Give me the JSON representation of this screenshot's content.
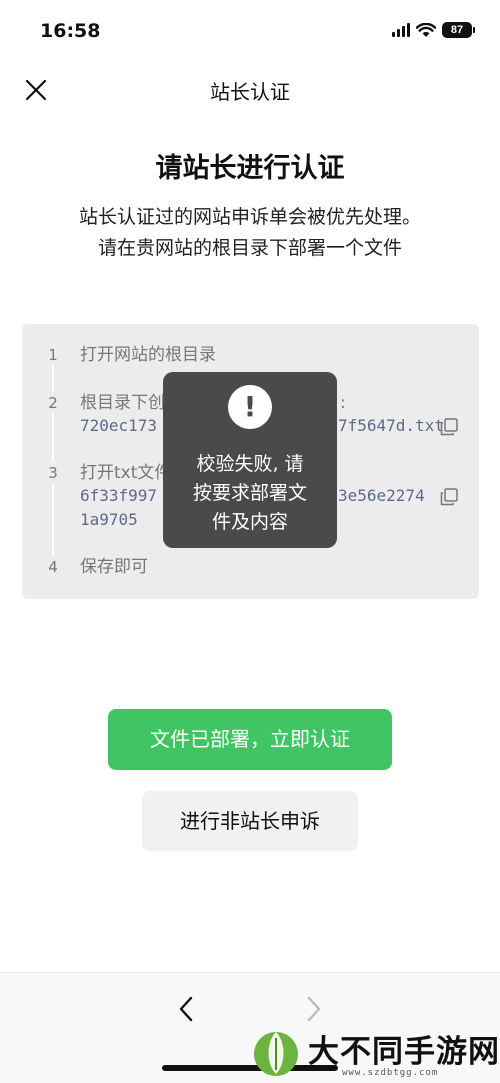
{
  "status_bar": {
    "time": "16:58",
    "battery": "87"
  },
  "nav": {
    "title": "站长认证"
  },
  "heading": "请站长进行认证",
  "description": [
    "站长认证过的网站申诉单会被优先处理。",
    "请在贵网站的根目录下部署一个文件"
  ],
  "steps": [
    {
      "number": "1",
      "text": "打开网站的根目录"
    },
    {
      "number": "2",
      "text": "根目录下创",
      "text_tail": ":",
      "code": "720ec173",
      "code_tail": "7f5647d.txt"
    },
    {
      "number": "3",
      "text": "打开txt文件",
      "code_line1": "6f33f997",
      "code_line1_tail": "3e56e2274",
      "code_line2": "1a9705"
    },
    {
      "number": "4",
      "text": "保存即可"
    }
  ],
  "toast": {
    "icon": "!",
    "message": [
      "校验失败, 请",
      "按要求部署文",
      "件及内容"
    ]
  },
  "buttons": {
    "primary": "文件已部署，立即认证",
    "secondary": "进行非站长申诉"
  },
  "watermark": {
    "text": "大不同手游网",
    "url": "www.szdbtgg.com"
  },
  "colors": {
    "primary_green": "#41c464",
    "toast_bg": "#4a4a4a",
    "card_bg": "#ececec"
  },
  "icons": [
    "close-icon",
    "alert-icon",
    "copy-icon",
    "back-arrow-icon",
    "forward-arrow-icon",
    "wifi-icon",
    "signal-icon",
    "battery-icon"
  ]
}
